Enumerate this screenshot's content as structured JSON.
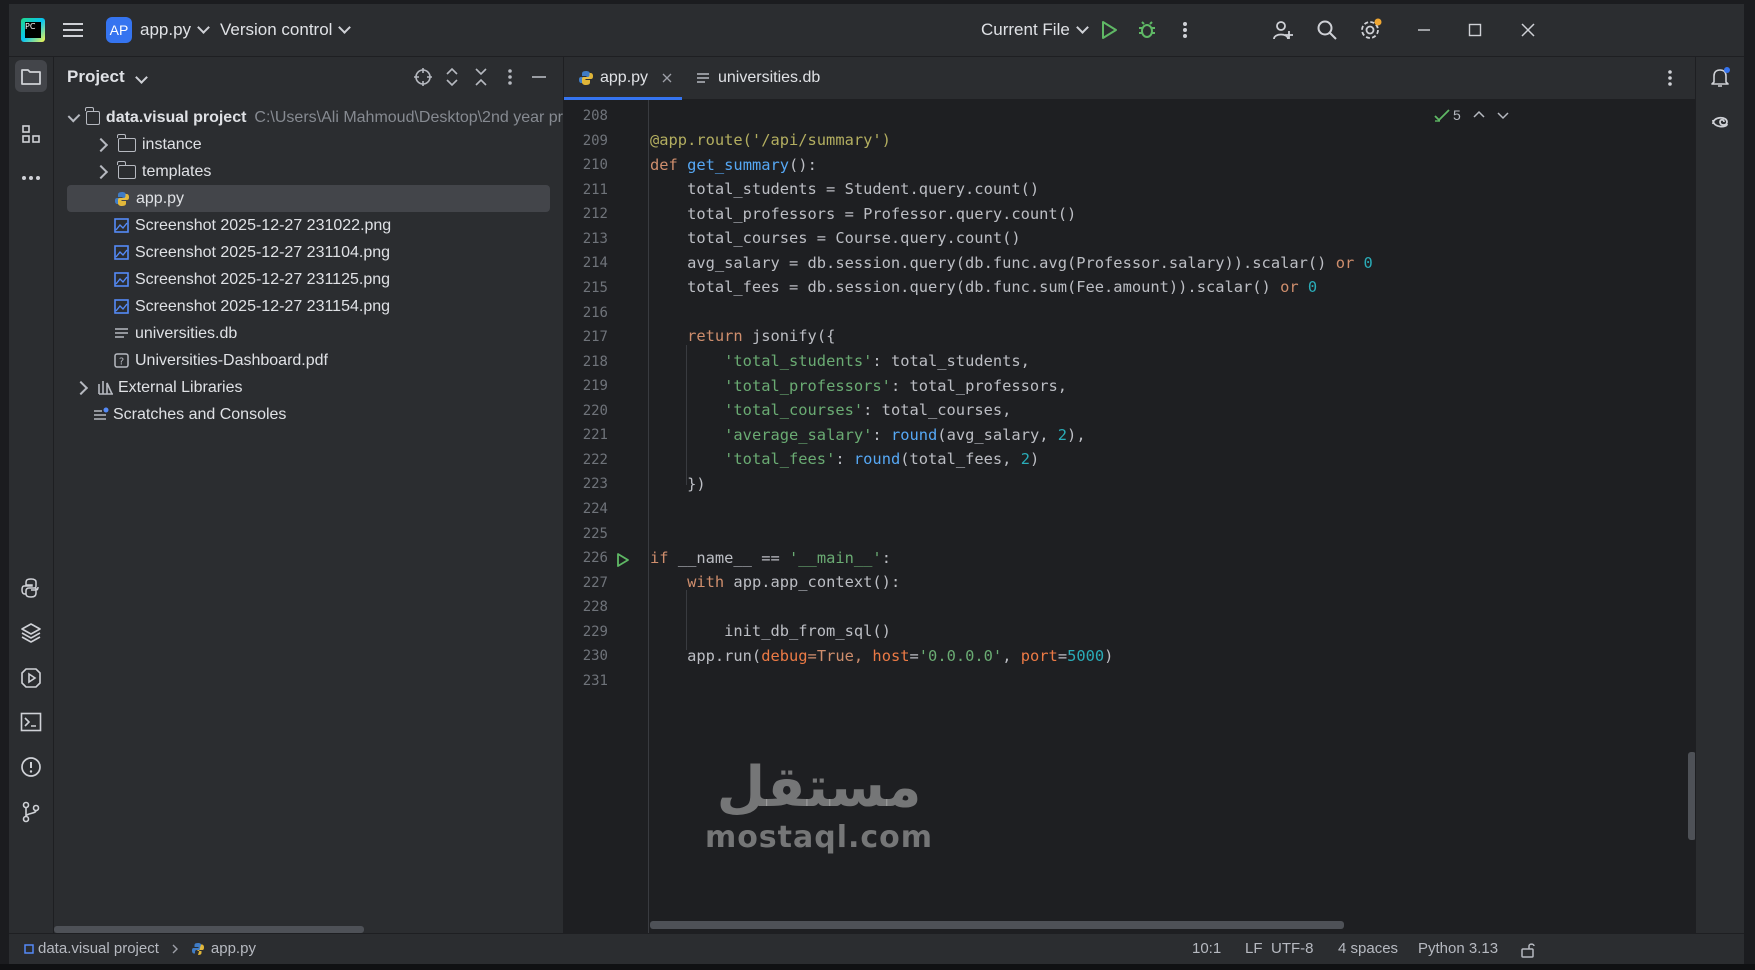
{
  "titlebar": {
    "project_badge": "AP",
    "project_name": "app.py",
    "vcs": "Version control",
    "run_config": "Current File"
  },
  "project_panel": {
    "title": "Project",
    "root": {
      "name": "data.visual project",
      "path": "C:\\Users\\Ali Mahmoud\\Desktop\\2nd year pr"
    },
    "items": [
      {
        "label": "instance",
        "type": "folder"
      },
      {
        "label": "templates",
        "type": "folder"
      },
      {
        "label": "app.py",
        "type": "python",
        "selected": true
      },
      {
        "label": "Screenshot 2025-12-27 231022.png",
        "type": "image"
      },
      {
        "label": "Screenshot 2025-12-27 231104.png",
        "type": "image"
      },
      {
        "label": "Screenshot 2025-12-27 231125.png",
        "type": "image"
      },
      {
        "label": "Screenshot 2025-12-27 231154.png",
        "type": "image"
      },
      {
        "label": "universities.db",
        "type": "db"
      },
      {
        "label": "Universities-Dashboard.pdf",
        "type": "unknown"
      }
    ],
    "external": "External Libraries",
    "scratches": "Scratches and Consoles"
  },
  "tabs": [
    {
      "label": "app.py",
      "active": true
    },
    {
      "label": "universities.db",
      "active": false
    }
  ],
  "inspection": {
    "count": "5"
  },
  "editor": {
    "line_numbers": [
      "208",
      "209",
      "210",
      "211",
      "212",
      "213",
      "214",
      "215",
      "216",
      "217",
      "218",
      "219",
      "220",
      "221",
      "222",
      "223",
      "224",
      "225",
      "226",
      "227",
      "228",
      "229",
      "230",
      "231"
    ],
    "code": {
      "l209": "@app.route('/api/summary')",
      "l210_kw": "def",
      "l210_fn": "get_summary",
      "l210_rest": "():",
      "l211": "    total_students = Student.query.count()",
      "l212": "    total_professors = Professor.query.count()",
      "l213": "    total_courses = Course.query.count()",
      "l214_a": "    avg_salary = db.session.query(db.func.avg(Professor.salary)).scalar() ",
      "l214_or": "or",
      "l214_n": "0",
      "l215_a": "    total_fees = db.session.query(db.func.sum(Fee.amount)).scalar() ",
      "l215_or": "or",
      "l215_n": "0",
      "l217_kw": "return",
      "l217_rest": " jsonify({",
      "l218_s": "'total_students'",
      "l218_r": ": total_students,",
      "l219_s": "'total_professors'",
      "l219_r": ": total_professors,",
      "l220_s": "'total_courses'",
      "l220_r": ": total_courses,",
      "l221_s": "'average_salary'",
      "l221_b": "round",
      "l221_a": "(avg_salary, ",
      "l221_n": "2",
      "l221_e": "),",
      "l222_s": "'total_fees'",
      "l222_b": "round",
      "l222_a": "(total_fees, ",
      "l222_n": "2",
      "l222_e": ")",
      "l223": "    })",
      "l226_kw": "if",
      "l226_a": " __name__ == ",
      "l226_s": "'__main__'",
      "l226_e": ":",
      "l227_kw": "with",
      "l227_rest": " app.app_context():",
      "l229": "        init_db_from_sql()",
      "l230_a": "    app.run(",
      "l230_p1": "debug",
      "l230_v1": "=True, ",
      "l230_p2": "host",
      "l230_eq": "=",
      "l230_s": "'0.0.0.0'",
      "l230_c": ", ",
      "l230_p3": "port",
      "l230_eq2": "=",
      "l230_n": "5000",
      "l230_e": ")"
    }
  },
  "statusbar": {
    "breadcrumb_project": "data.visual project",
    "breadcrumb_file": "app.py",
    "position": "10:1",
    "line_sep": "LF",
    "encoding": "UTF-8",
    "indent": "4 spaces",
    "interpreter": "Python 3.13"
  },
  "watermark": {
    "arabic": "مستقل",
    "latin": "mostaql.com"
  },
  "colors": {
    "accent": "#3574f0",
    "run_green": "#5fb865",
    "keyword": "#cf8e6d",
    "string": "#6aab73",
    "number": "#2aacb8",
    "function": "#56a8f5"
  }
}
